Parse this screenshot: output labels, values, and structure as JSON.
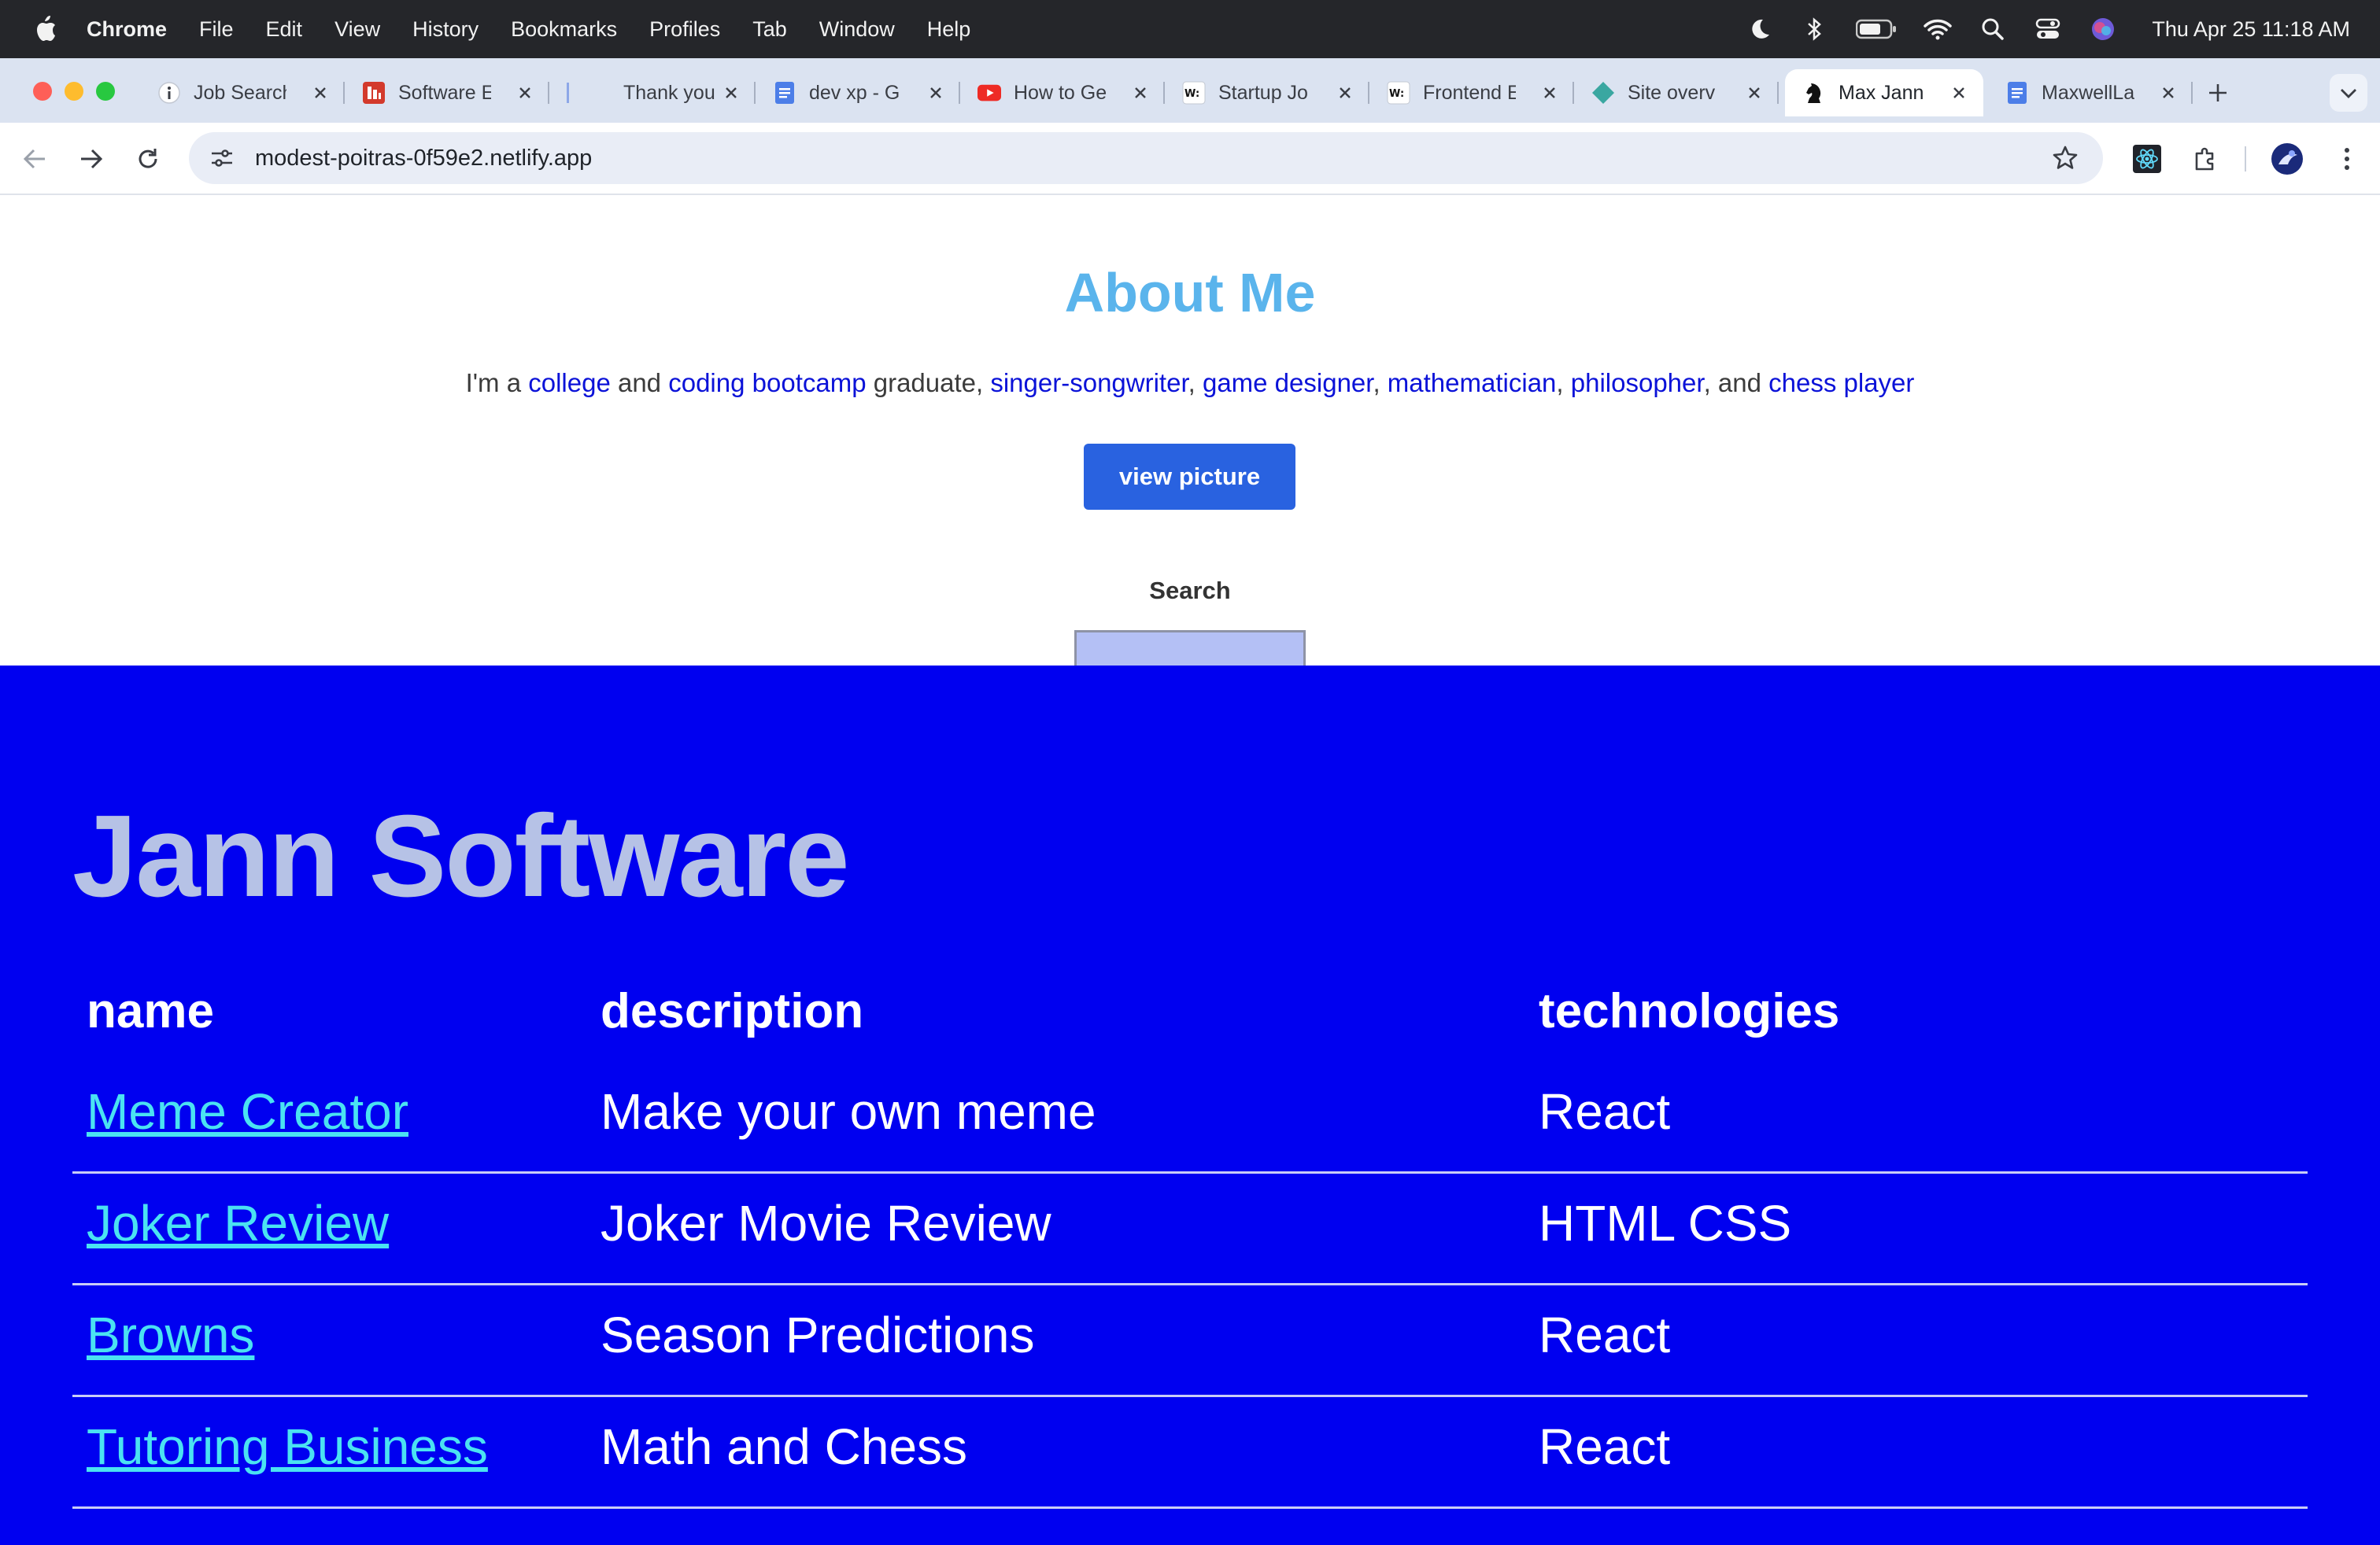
{
  "menubar": {
    "app": "Chrome",
    "items": [
      "File",
      "Edit",
      "View",
      "History",
      "Bookmarks",
      "Profiles",
      "Tab",
      "Window",
      "Help"
    ],
    "clock": "Thu Apr 25  11:18 AM"
  },
  "tabs": [
    {
      "title": "Job Search",
      "icon": "info-icon"
    },
    {
      "title": "Software E",
      "icon": "app-icon"
    },
    {
      "title": "Thank you",
      "icon": "blank-icon"
    },
    {
      "title": "dev xp - G",
      "icon": "docs-icon"
    },
    {
      "title": "How to Ge",
      "icon": "youtube-icon"
    },
    {
      "title": "Startup Jo",
      "icon": "wellfound-icon"
    },
    {
      "title": "Frontend E",
      "icon": "wellfound-icon"
    },
    {
      "title": "Site overv",
      "icon": "netlify-icon"
    },
    {
      "title": "Max Jann",
      "icon": "chess-knight-icon",
      "active": true
    },
    {
      "title": "MaxwellLa",
      "icon": "docs-icon"
    }
  ],
  "toolbar": {
    "url": "modest-poitras-0f59e2.netlify.app"
  },
  "about": {
    "title": "About Me",
    "intro": "I'm a ",
    "college": "college",
    "and1": " and ",
    "bootcamp": "coding bootcamp",
    "graduate": " graduate, ",
    "singer": "singer-songwriter",
    "comma1": ", ",
    "game": "game designer",
    "comma2": ", ",
    "math": "mathematician",
    "comma3": ", ",
    "philosopher": "philosopher",
    "and2": ", and ",
    "chess": "chess player",
    "button": "view picture",
    "search_label": "Search",
    "search_value": ""
  },
  "software": {
    "title": "Jann Software",
    "columns": [
      "name",
      "description",
      "technologies"
    ],
    "rows": [
      {
        "name": "Meme Creator",
        "description": "Make your own meme",
        "technologies": "React"
      },
      {
        "name": "Joker Review",
        "description": "Joker Movie Review",
        "technologies": "HTML CSS"
      },
      {
        "name": "Browns",
        "description": "Season Predictions",
        "technologies": "React"
      },
      {
        "name": "Tutoring Business",
        "description": "Math and Chess",
        "technologies": "React"
      }
    ]
  },
  "colors": {
    "heading": "#5ab4ec",
    "link": "#0b12d8",
    "button": "#2962e0",
    "software_bg": "#0000f0",
    "table_link": "#4ae2f2"
  }
}
